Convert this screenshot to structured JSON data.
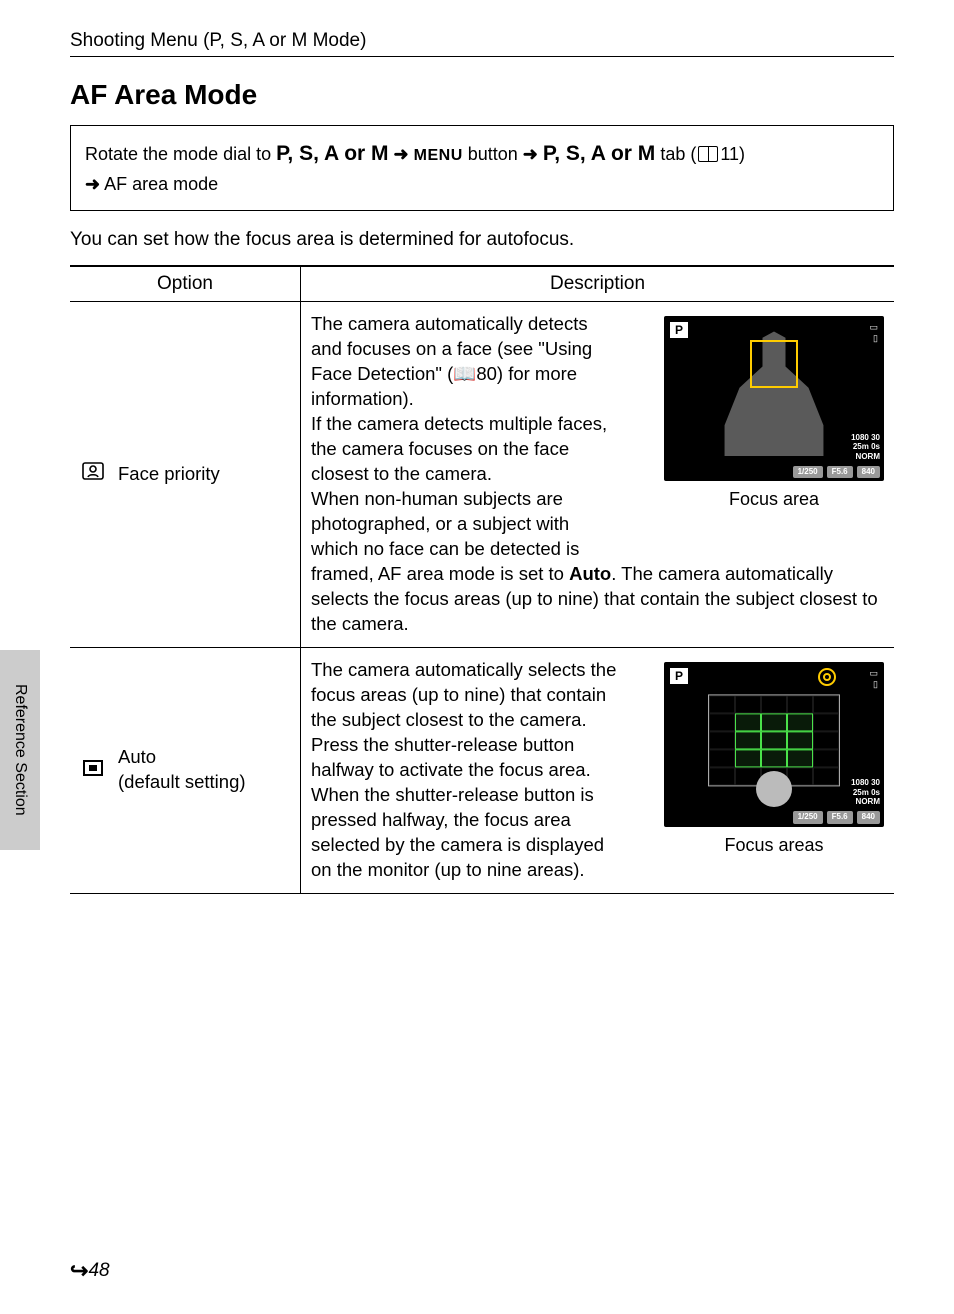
{
  "header": "Shooting Menu (P, S, A or M Mode)",
  "section_title": "AF Area Mode",
  "nav": {
    "line1_prefix": "Rotate the mode dial to ",
    "modes": "P, S, A or M",
    "arrow": " ➜ ",
    "menu_word": "MENU",
    "line1_mid": " button ",
    "line1_tab": " tab (",
    "ref1": "11)",
    "line2": " AF area mode"
  },
  "intro": "You can set how the focus area is determined for autofocus.",
  "table": {
    "h_option": "Option",
    "h_desc": "Description",
    "rows": [
      {
        "label": "Face priority",
        "desc_upper": "The camera automatically detects and focuses on a face (see \"Using Face Detection\" (📖80) for more information).\nIf the camera detects multiple faces, the camera focuses on the face closest to the camera.\nWhen non-human subjects are photographed, or a subject with which no face can be detected is",
        "desc_lower_pre": "framed, AF area mode is set to ",
        "desc_lower_bold": "Auto",
        "desc_lower_post": ". The camera automatically selects the focus areas (up to nine) that contain the subject closest to the camera.",
        "lcd_caption": "Focus area",
        "lcd": {
          "p": "P",
          "info1": "1080 30",
          "info2": "25m 0s",
          "info3": "NORM",
          "pill1": "1/250",
          "pill2": "F5.6",
          "pill3": "840"
        }
      },
      {
        "label_line1": "Auto",
        "label_line2": "(default setting)",
        "desc": "The camera automatically selects the focus areas (up to nine) that contain the subject closest to the camera.\nPress the shutter-release button halfway to activate the focus area. When the shutter-release button is pressed halfway, the focus area selected by the camera is displayed on the monitor (up to nine areas).",
        "lcd_caption": "Focus areas",
        "lcd": {
          "p": "P",
          "info1": "1080 30",
          "info2": "25m 0s",
          "info3": "NORM",
          "pill1": "1/250",
          "pill2": "F5.6",
          "pill3": "840"
        }
      }
    ]
  },
  "sidebar": "Reference Section",
  "footer": {
    "page": "48"
  }
}
